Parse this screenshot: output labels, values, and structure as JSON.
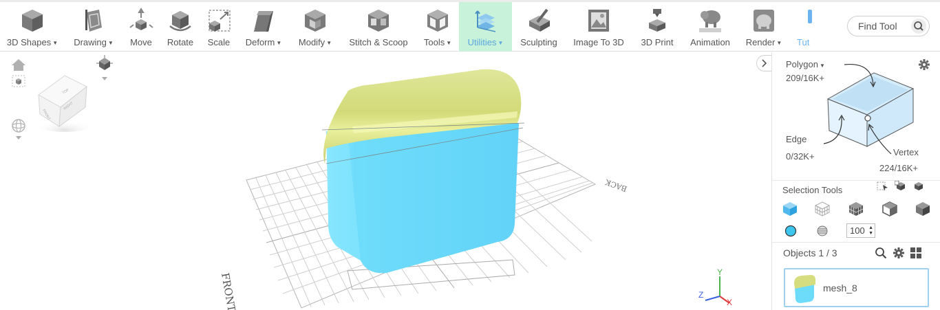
{
  "toolbar": {
    "tools": [
      {
        "label": "3D Shapes",
        "dropdown": true,
        "icon": "cube-icon"
      },
      {
        "label": "Drawing",
        "dropdown": true,
        "icon": "drawing-icon"
      },
      {
        "label": "Move",
        "dropdown": false,
        "icon": "move-icon"
      },
      {
        "label": "Rotate",
        "dropdown": false,
        "icon": "rotate-icon"
      },
      {
        "label": "Scale",
        "dropdown": false,
        "icon": "scale-icon"
      },
      {
        "label": "Deform",
        "dropdown": true,
        "icon": "deform-icon"
      },
      {
        "label": "Modify",
        "dropdown": true,
        "icon": "modify-icon"
      },
      {
        "label": "Stitch & Scoop",
        "dropdown": false,
        "icon": "stitch-scoop-icon"
      },
      {
        "label": "Tools",
        "dropdown": true,
        "icon": "tools-icon"
      },
      {
        "label": "Utilities",
        "dropdown": true,
        "icon": "utilities-icon",
        "active": true
      },
      {
        "label": "Sculpting",
        "dropdown": false,
        "icon": "sculpting-icon"
      },
      {
        "label": "Image To 3D",
        "dropdown": false,
        "icon": "image-to-3d-icon"
      },
      {
        "label": "3D Print",
        "dropdown": false,
        "icon": "3d-print-icon"
      },
      {
        "label": "Animation",
        "dropdown": false,
        "icon": "animation-icon"
      },
      {
        "label": "Render",
        "dropdown": true,
        "icon": "render-icon"
      },
      {
        "label": "Tut",
        "dropdown": false,
        "icon": "tutorial-icon",
        "partial": true
      }
    ],
    "find_tool": {
      "label": "Find Tool",
      "icon": "search-icon"
    }
  },
  "viewport": {
    "labels": {
      "front": "FRONT",
      "back": "BACK",
      "x": "X",
      "y": "Y",
      "z": "Z"
    },
    "view_cube_faces": {
      "front": "FRONT",
      "right": "RIGHT",
      "top": "TOP"
    },
    "colors": {
      "lid": "#d3dc7a",
      "body": "#6cdcfa",
      "grid": "#c8c8c8",
      "axis_x": "#e03a3a",
      "axis_y": "#4bb34b",
      "axis_z": "#3a5fe0"
    }
  },
  "panel": {
    "polygon": {
      "label": "Polygon",
      "count": "209/16K+"
    },
    "edge": {
      "label": "Edge",
      "count": "0/32K+"
    },
    "vertex": {
      "label": "Vertex",
      "count": "224/16K+"
    },
    "selection_tools": {
      "label": "Selection Tools"
    },
    "brush_size": "100",
    "objects": {
      "label": "Objects 1 / 3"
    },
    "object_list": [
      {
        "name": "mesh_8"
      }
    ],
    "colors": {
      "accent": "#3fb6e8",
      "selected_border": "#9fd0ee"
    }
  }
}
